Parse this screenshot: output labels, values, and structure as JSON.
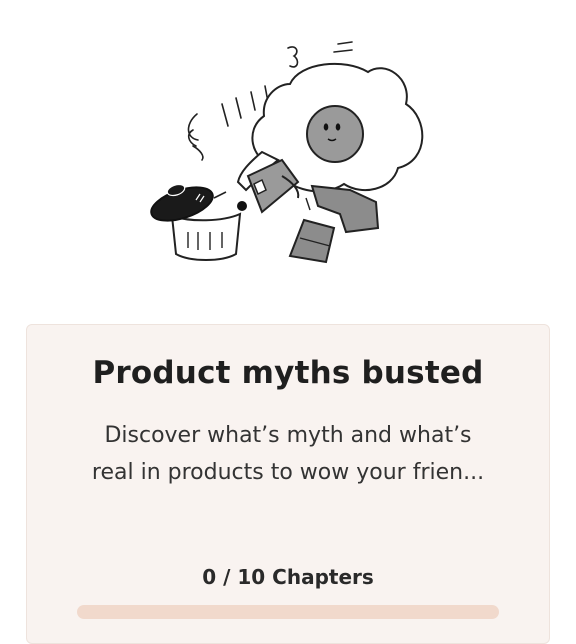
{
  "illustration": {
    "name": "egg-character-cooking-illustration"
  },
  "card": {
    "title": "Product myths busted",
    "description_line1": "Discover what’s myth and what’s",
    "description_line2": "real in products to wow your frien...",
    "progress_label": "0 / 10 Chapters",
    "progress_fraction": 0.0
  },
  "colors": {
    "card_background": "#f9f3f0",
    "progress_track": "#f1d9cc",
    "progress_fill": "#e07a52",
    "title_text": "#1f1f1f"
  }
}
